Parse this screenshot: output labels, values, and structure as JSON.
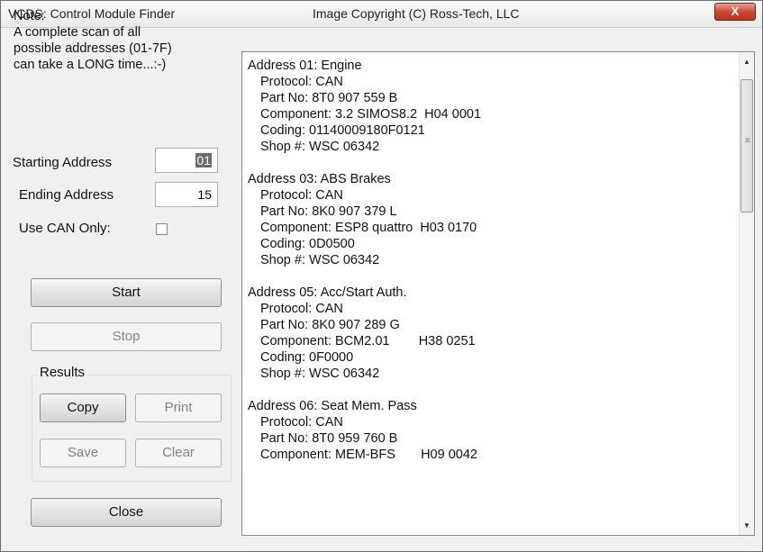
{
  "window": {
    "title": "VCDS:  Control Module Finder",
    "subtitle": "Image Copyright (C) Ross-Tech, LLC",
    "close_glyph": "X"
  },
  "note": {
    "lines": [
      "Note:",
      "A complete scan of all",
      "possible addresses (01-7F)",
      "can take a  LONG time...:-)"
    ]
  },
  "starting_address": {
    "label": "Starting Address",
    "value": "01"
  },
  "ending_address": {
    "label": "Ending Address",
    "value": "15"
  },
  "can_only": {
    "label": "Use CAN Only:",
    "checked": false
  },
  "buttons": {
    "start": "Start",
    "stop": "Stop",
    "copy": "Copy",
    "print": "Print",
    "save": "Save",
    "clear": "Clear",
    "close": "Close"
  },
  "results_group": {
    "label": "Results"
  },
  "modules": [
    {
      "header": "Address 01: Engine",
      "protocol": "Protocol: CAN",
      "part_no": "Part No: 8T0 907 559 B",
      "component": "Component: 3.2 SIMOS8.2  H04 0001",
      "coding": "Coding: 01140009180F0121",
      "shop": "Shop #: WSC 06342"
    },
    {
      "header": "Address 03: ABS Brakes",
      "protocol": "Protocol: CAN",
      "part_no": "Part No: 8K0 907 379 L",
      "component": "Component: ESP8 quattro  H03 0170",
      "coding": "Coding: 0D0500",
      "shop": "Shop #: WSC 06342"
    },
    {
      "header": "Address 05: Acc/Start Auth.",
      "protocol": "Protocol: CAN",
      "part_no": "Part No: 8K0 907 289 G",
      "component": "Component: BCM2.01        H38 0251",
      "coding": "Coding: 0F0000",
      "shop": "Shop #: WSC 06342"
    },
    {
      "header": "Address 06: Seat Mem. Pass",
      "protocol": "Protocol: CAN",
      "part_no": "Part No: 8T0 959 760 B",
      "component": "Component: MEM-BFS       H09 0042"
    }
  ]
}
